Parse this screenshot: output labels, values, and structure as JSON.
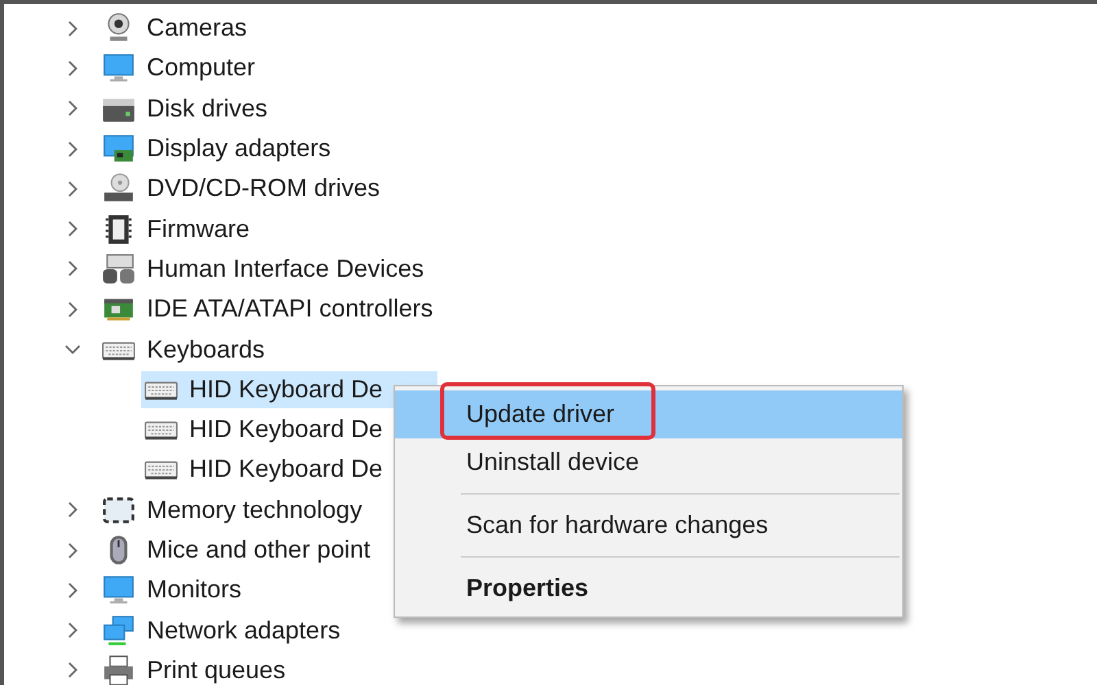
{
  "tree": [
    {
      "label": "Cameras",
      "kind": "camera",
      "expanded": false
    },
    {
      "label": "Computer",
      "kind": "monitor",
      "expanded": false
    },
    {
      "label": "Disk drives",
      "kind": "disk",
      "expanded": false
    },
    {
      "label": "Display adapters",
      "kind": "display",
      "expanded": false
    },
    {
      "label": "DVD/CD-ROM drives",
      "kind": "dvd",
      "expanded": false
    },
    {
      "label": "Firmware",
      "kind": "chip",
      "expanded": false
    },
    {
      "label": "Human Interface Devices",
      "kind": "hid",
      "expanded": false
    },
    {
      "label": "IDE ATA/ATAPI controllers",
      "kind": "card",
      "expanded": false
    },
    {
      "label": "Keyboards",
      "kind": "keyboard",
      "expanded": true,
      "children": [
        {
          "label": "HID Keyboard De",
          "kind": "keyboard",
          "selected": true
        },
        {
          "label": "HID Keyboard De",
          "kind": "keyboard",
          "selected": false
        },
        {
          "label": "HID Keyboard De",
          "kind": "keyboard",
          "selected": false
        }
      ]
    },
    {
      "label": "Memory technology",
      "kind": "memory",
      "expanded": false
    },
    {
      "label": "Mice and other point",
      "kind": "mouse",
      "expanded": false
    },
    {
      "label": "Monitors",
      "kind": "monitor",
      "expanded": false
    },
    {
      "label": "Network adapters",
      "kind": "network",
      "expanded": false
    },
    {
      "label": "Print queues",
      "kind": "printer",
      "expanded": false
    }
  ],
  "context_menu": [
    {
      "label": "Update driver",
      "selected": true,
      "highlighted": true,
      "default": false,
      "separator_before": false
    },
    {
      "label": "Uninstall device",
      "selected": false,
      "highlighted": false,
      "default": false,
      "separator_before": false
    },
    {
      "label": "Scan for hardware changes",
      "selected": false,
      "highlighted": false,
      "default": false,
      "separator_before": true
    },
    {
      "label": "Properties",
      "selected": false,
      "highlighted": false,
      "default": true,
      "separator_before": true
    }
  ]
}
